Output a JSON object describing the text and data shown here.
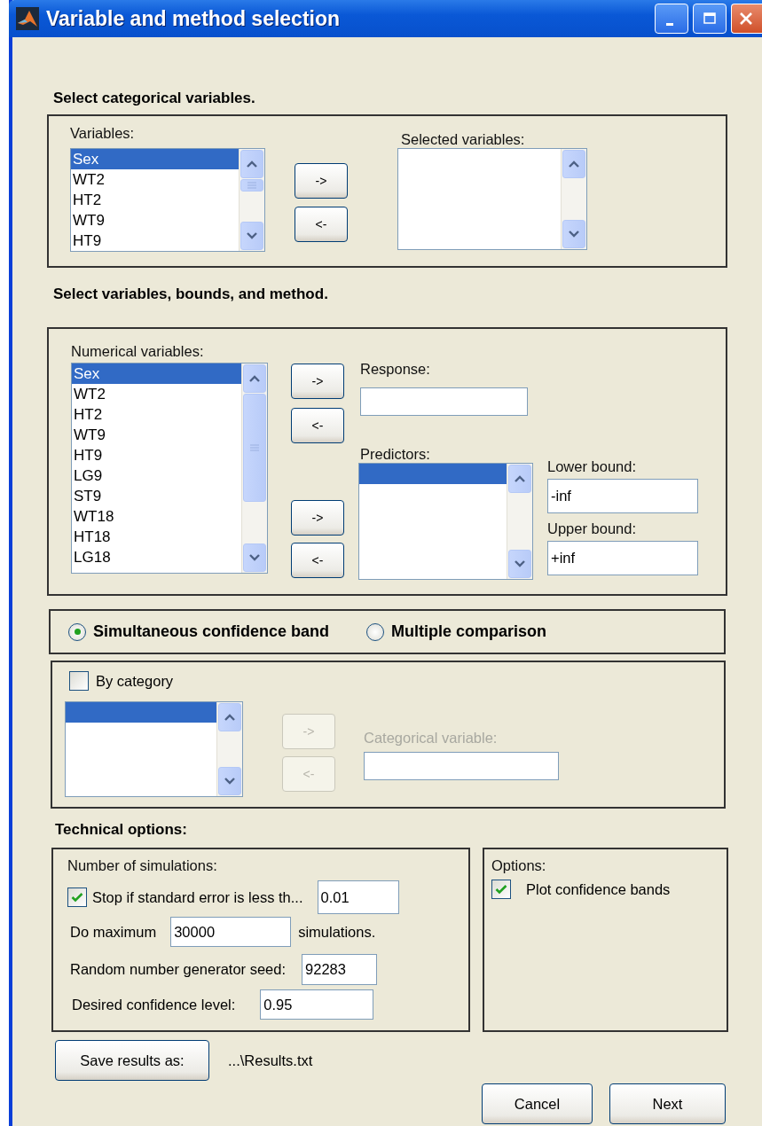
{
  "window": {
    "title": "Variable and method selection"
  },
  "categorical": {
    "heading": "Select categorical variables.",
    "variables": {
      "label": "Variables:",
      "items": [
        {
          "text": "Sex",
          "selected": true
        },
        {
          "text": "WT2",
          "selected": false
        },
        {
          "text": "HT2",
          "selected": false
        },
        {
          "text": "WT9",
          "selected": false
        },
        {
          "text": "HT9",
          "selected": false
        }
      ]
    },
    "buttons": [
      {
        "label": "->"
      },
      {
        "label": "<-"
      }
    ],
    "selected": {
      "label": "Selected variables:"
    }
  },
  "numeric": {
    "heading": "Select variables, bounds, and method.",
    "variables": {
      "label": "Numerical variables:",
      "items": [
        {
          "text": "Sex",
          "selected": true
        },
        {
          "text": "WT2",
          "selected": false
        },
        {
          "text": "HT2",
          "selected": false
        },
        {
          "text": "WT9",
          "selected": false
        },
        {
          "text": "HT9",
          "selected": false
        },
        {
          "text": "LG9",
          "selected": false
        },
        {
          "text": "ST9",
          "selected": false
        },
        {
          "text": "WT18",
          "selected": false
        },
        {
          "text": "HT18",
          "selected": false
        },
        {
          "text": "LG18",
          "selected": false
        }
      ]
    },
    "response_buttons": [
      {
        "label": "->"
      },
      {
        "label": "<-"
      }
    ],
    "response": {
      "label": "Response:"
    },
    "predictor_buttons": [
      {
        "label": "->"
      },
      {
        "label": "<-"
      }
    ],
    "predictors": {
      "label": "Predictors:",
      "rows": [
        {
          "selected": true
        }
      ]
    },
    "lower_bound": {
      "label": "Lower bound:",
      "value": "-inf"
    },
    "upper_bound": {
      "label": "Upper bound:",
      "value": "+inf"
    }
  },
  "method": [
    {
      "label": "Simultaneous confidence band",
      "selected": true
    },
    {
      "label": "Multiple comparison",
      "selected": false
    }
  ],
  "by_category": {
    "label": "By category",
    "checked": false,
    "list": {
      "rows": [
        {
          "selected": true
        }
      ]
    },
    "buttons": [
      {
        "label": "->",
        "disabled": true
      },
      {
        "label": "<-",
        "disabled": true
      }
    ],
    "field": {
      "label": "Categorical variable:",
      "disabled": true
    }
  },
  "technical": {
    "heading": "Technical options:",
    "simulations": {
      "label": "Number of simulations:",
      "stop": {
        "label": "Stop if standard error is less th...",
        "checked": true,
        "value": "0.01"
      },
      "maximum": {
        "label": "Do maximum",
        "value": "30000",
        "suffix": "simulations."
      },
      "seed": {
        "label": "Random number generator seed:",
        "value": "92283"
      },
      "confidence": {
        "label": "Desired confidence level:",
        "value": "0.95"
      }
    },
    "options": {
      "label": "Options:",
      "items": [
        {
          "label": "Plot confidence bands",
          "checked": true
        }
      ]
    }
  },
  "save": {
    "button": "Save results as:",
    "path": "...\\Results.txt"
  },
  "footer_buttons": [
    {
      "label": "Cancel"
    },
    {
      "label": "Next"
    }
  ]
}
